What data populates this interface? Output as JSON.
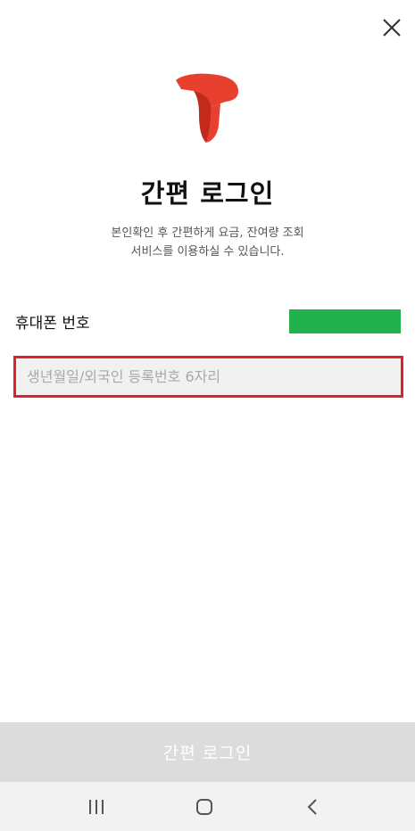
{
  "header": {
    "close_icon": "close-icon"
  },
  "brand": {
    "logo_icon": "t-logo-icon",
    "logo_color": "#e8402f"
  },
  "title": "간편 로그인",
  "subtitle": {
    "line1": "본인확인 후 간편하게 요금, 잔여량 조회",
    "line2": "서비스를 이용하실 수 있습니다."
  },
  "form": {
    "phone_label": "휴대폰 번호",
    "phone_value_color": "#22b14c",
    "birth_placeholder": "생년월일/외국인 등록번호 6자리",
    "birth_value": "",
    "highlight_color": "#e0202a"
  },
  "submit": {
    "label": "간편 로그인"
  },
  "navigation": {
    "recent_icon": "recent-apps-icon",
    "home_icon": "home-icon",
    "back_icon": "back-icon"
  }
}
